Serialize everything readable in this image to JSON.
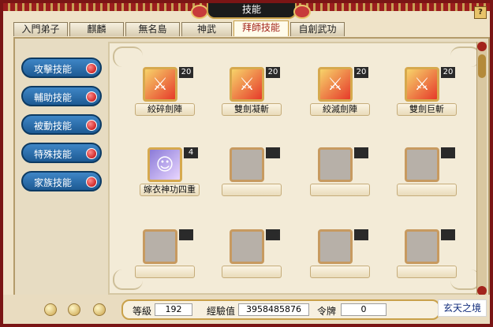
{
  "window": {
    "title": "技能",
    "help_label": "?"
  },
  "tabs": [
    {
      "label": "入門弟子",
      "active": false
    },
    {
      "label": "麒麟",
      "active": false
    },
    {
      "label": "無名島",
      "active": false
    },
    {
      "label": "神武",
      "active": false
    },
    {
      "label": "拜師技能",
      "active": true
    },
    {
      "label": "自創武功",
      "active": false
    }
  ],
  "sidebar": {
    "buttons": [
      {
        "label": "攻擊技能"
      },
      {
        "label": "輔助技能"
      },
      {
        "label": "被動技能"
      },
      {
        "label": "特殊技能"
      },
      {
        "label": "家族技能"
      }
    ]
  },
  "skills": [
    {
      "name": "絞碎劍陣",
      "level": "20",
      "icon": "sword-slash-icon"
    },
    {
      "name": "雙劍凝斬",
      "level": "20",
      "icon": "twin-blade-icon"
    },
    {
      "name": "絞滅劍陣",
      "level": "20",
      "icon": "sword-slash-icon"
    },
    {
      "name": "雙劍巨斬",
      "level": "20",
      "icon": "twin-blade-icon"
    },
    {
      "name": "嫁衣神功四重",
      "level": "4",
      "icon": "buff-girl-icon"
    }
  ],
  "status": {
    "level_label": "等級",
    "level_value": "192",
    "exp_label": "經驗值",
    "exp_value": "3958485876",
    "token_label": "令牌",
    "token_value": "0"
  },
  "location": "玄天之境",
  "colors": {
    "frame": "#7a1515",
    "tab_active_text": "#a3241c",
    "side_button": "#2a6eab"
  }
}
